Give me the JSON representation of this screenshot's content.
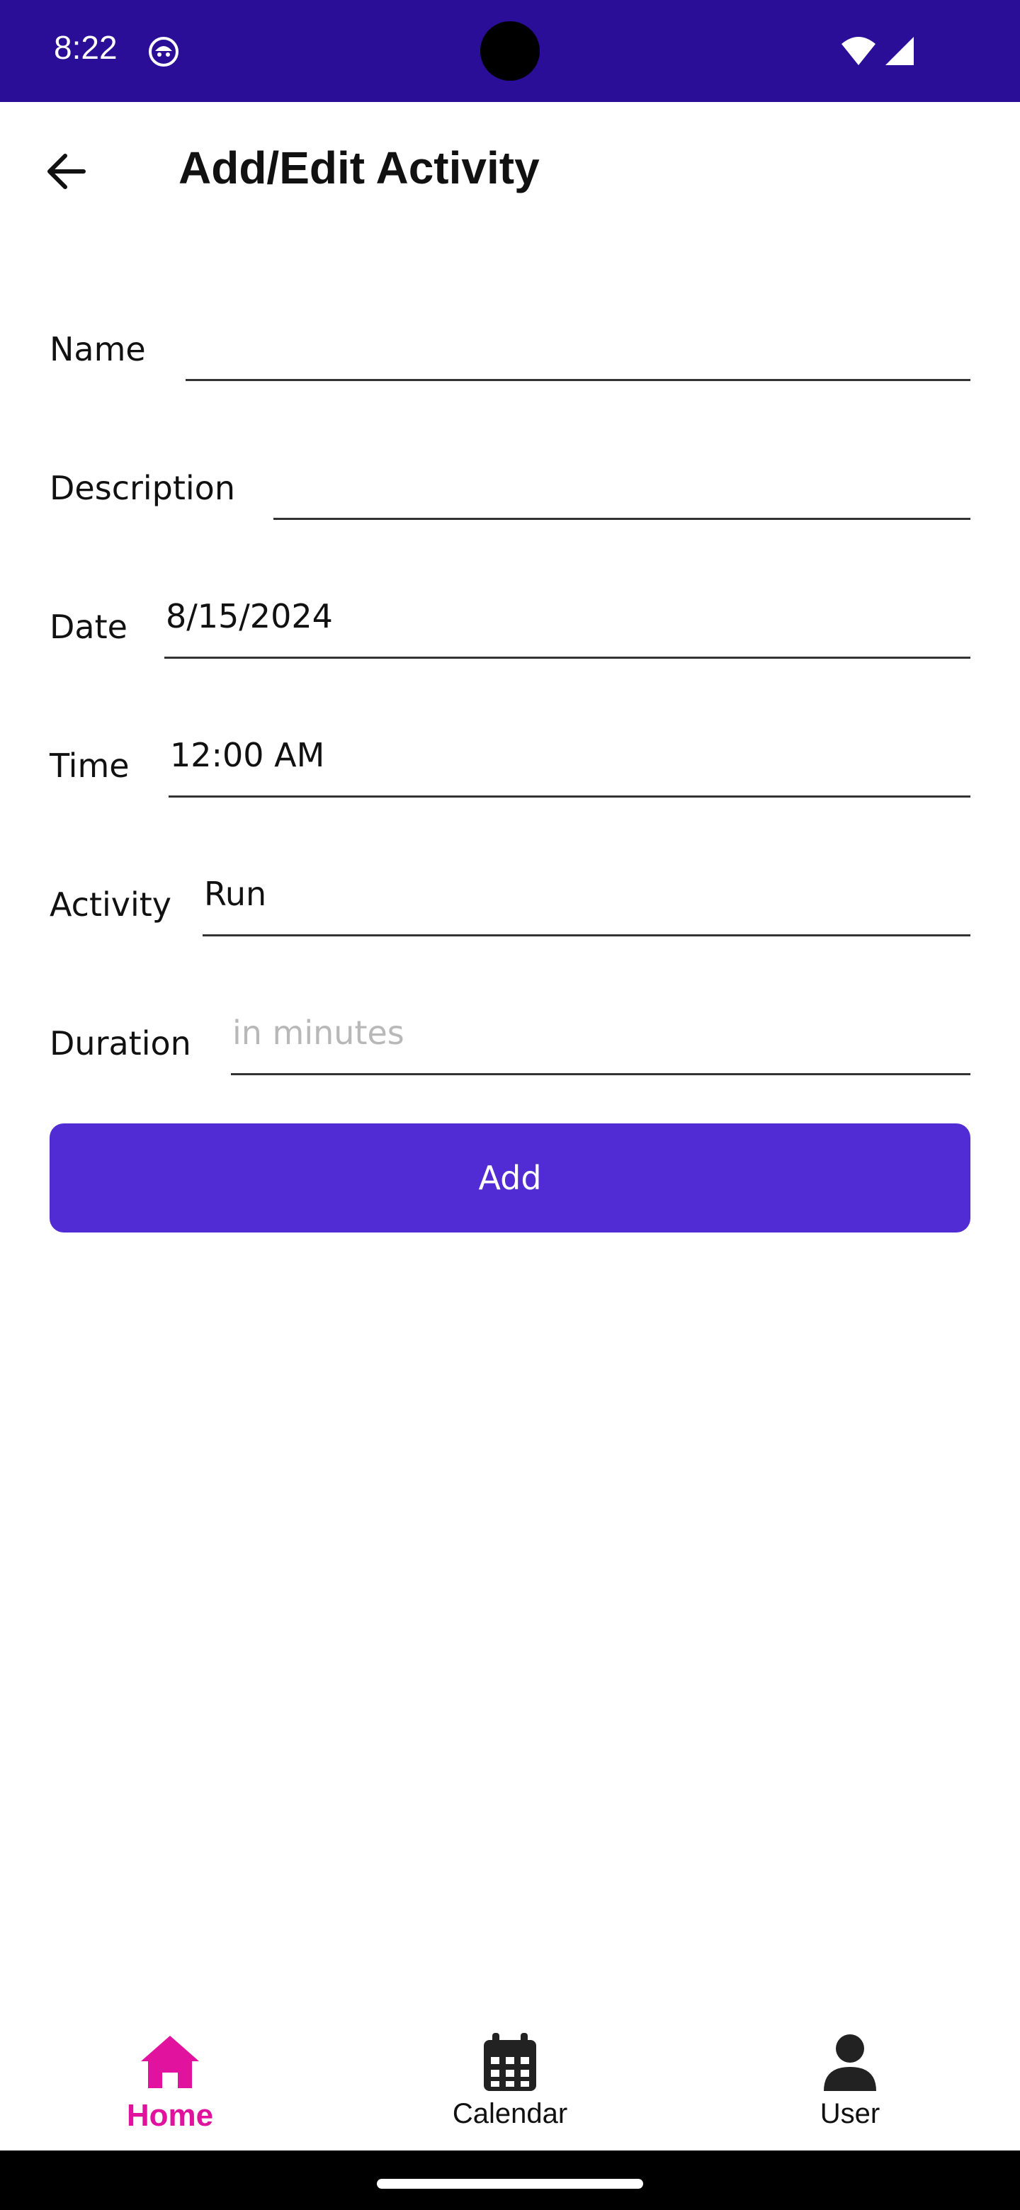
{
  "status_bar": {
    "time": "8:22",
    "background": "#2a0e98"
  },
  "app_bar": {
    "title": "Add/Edit Activity",
    "back_icon": "arrow-left-icon"
  },
  "form": {
    "name": {
      "label": "Name",
      "value": "",
      "placeholder": ""
    },
    "description": {
      "label": "Description",
      "value": "",
      "placeholder": ""
    },
    "date": {
      "label": "Date",
      "value": "8/15/2024",
      "placeholder": ""
    },
    "time": {
      "label": "Time",
      "value": "12:00 AM",
      "placeholder": ""
    },
    "activity": {
      "label": "Activity",
      "value": "Run",
      "placeholder": ""
    },
    "duration": {
      "label": "Duration",
      "value": "",
      "placeholder": "in minutes"
    },
    "submit_label": "Add",
    "accent": "#512bd4"
  },
  "bottom_nav": {
    "items": [
      {
        "label": "Home",
        "icon": "home-icon",
        "active": true
      },
      {
        "label": "Calendar",
        "icon": "calendar-icon",
        "active": false
      },
      {
        "label": "User",
        "icon": "user-icon",
        "active": false
      }
    ],
    "active_color": "#e0129e"
  }
}
